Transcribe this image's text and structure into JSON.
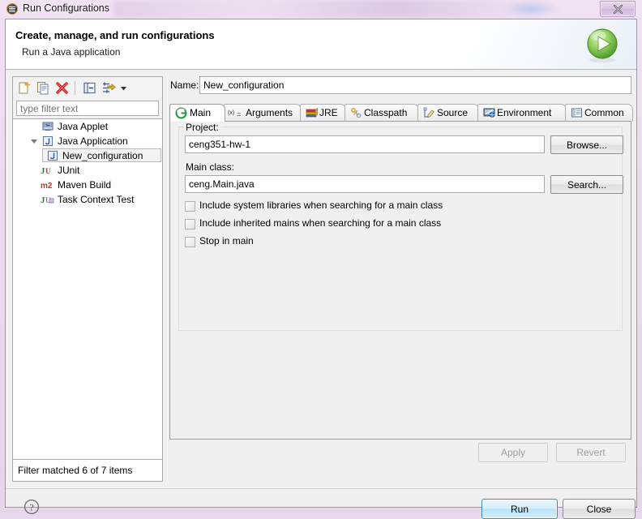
{
  "window": {
    "title": "Run Configurations",
    "title_icon": "run-config-icon",
    "close_label": "✕"
  },
  "header": {
    "title": "Create, manage, and run configurations",
    "subtitle": "Run a Java application",
    "badge_icon": "green-play-circle-icon"
  },
  "toolbar": {
    "items": [
      {
        "name": "new-launch-configuration-icon",
        "tooltip": "New launch configuration"
      },
      {
        "name": "duplicate-icon",
        "tooltip": "Duplicate"
      },
      {
        "name": "delete-icon",
        "tooltip": "Delete"
      },
      {
        "name": "collapse-all-icon",
        "tooltip": "Collapse All"
      },
      {
        "name": "filter-icon",
        "tooltip": "Filter"
      },
      {
        "name": "chevron-down-icon",
        "tooltip": "Menu"
      }
    ]
  },
  "filter": {
    "placeholder": "type filter text",
    "value": "",
    "status": "Filter matched 6 of 7 items"
  },
  "tree": {
    "items": [
      {
        "label": "Java Applet",
        "icon": "java-applet-icon",
        "indent": 0,
        "expander": "none",
        "selected": false
      },
      {
        "label": "Java Application",
        "icon": "java-application-icon",
        "indent": 0,
        "expander": "expanded",
        "selected": false
      },
      {
        "label": "New_configuration",
        "icon": "java-application-icon",
        "indent": 1,
        "expander": "none",
        "selected": true
      },
      {
        "label": "JUnit",
        "icon": "junit-icon",
        "indent": 0,
        "expander": "none",
        "selected": false
      },
      {
        "label": "Maven Build",
        "icon": "maven-icon",
        "indent": 0,
        "expander": "none",
        "selected": false
      },
      {
        "label": "Task Context Test",
        "icon": "task-context-test-icon",
        "indent": 0,
        "expander": "none",
        "selected": false
      }
    ]
  },
  "name_field": {
    "label": "Name:",
    "value": "New_configuration",
    "placeholder": ""
  },
  "tabs": [
    {
      "label": "Main",
      "icon": "main-tab-icon",
      "active": true
    },
    {
      "label": "Arguments",
      "icon": "arguments-tab-icon",
      "active": false
    },
    {
      "label": "JRE",
      "icon": "jre-tab-icon",
      "active": false
    },
    {
      "label": "Classpath",
      "icon": "classpath-tab-icon",
      "active": false
    },
    {
      "label": "Source",
      "icon": "source-tab-icon",
      "active": false
    },
    {
      "label": "Environment",
      "icon": "environment-tab-icon",
      "active": false
    },
    {
      "label": "Common",
      "icon": "common-tab-icon",
      "active": false
    }
  ],
  "main_tab": {
    "project": {
      "label": "Project:",
      "value": "ceng351-hw-1",
      "button": "Browse..."
    },
    "main_class": {
      "label": "Main class:",
      "value": "ceng.Main.java",
      "button": "Search..."
    },
    "checkboxes": [
      {
        "label": "Include system libraries when searching for a main class",
        "checked": false
      },
      {
        "label": "Include inherited mains when searching for a main class",
        "checked": false
      },
      {
        "label": "Stop in main",
        "checked": false
      }
    ]
  },
  "actions": {
    "apply": "Apply",
    "revert": "Revert",
    "run": "Run",
    "close": "Close",
    "help_icon": "help-question-icon"
  },
  "colors": {
    "accent_blue": "#2e8fd0",
    "run_green": "#6cbf3f",
    "delete_red": "#cc2222",
    "titlebar": "#e8d8ec"
  }
}
